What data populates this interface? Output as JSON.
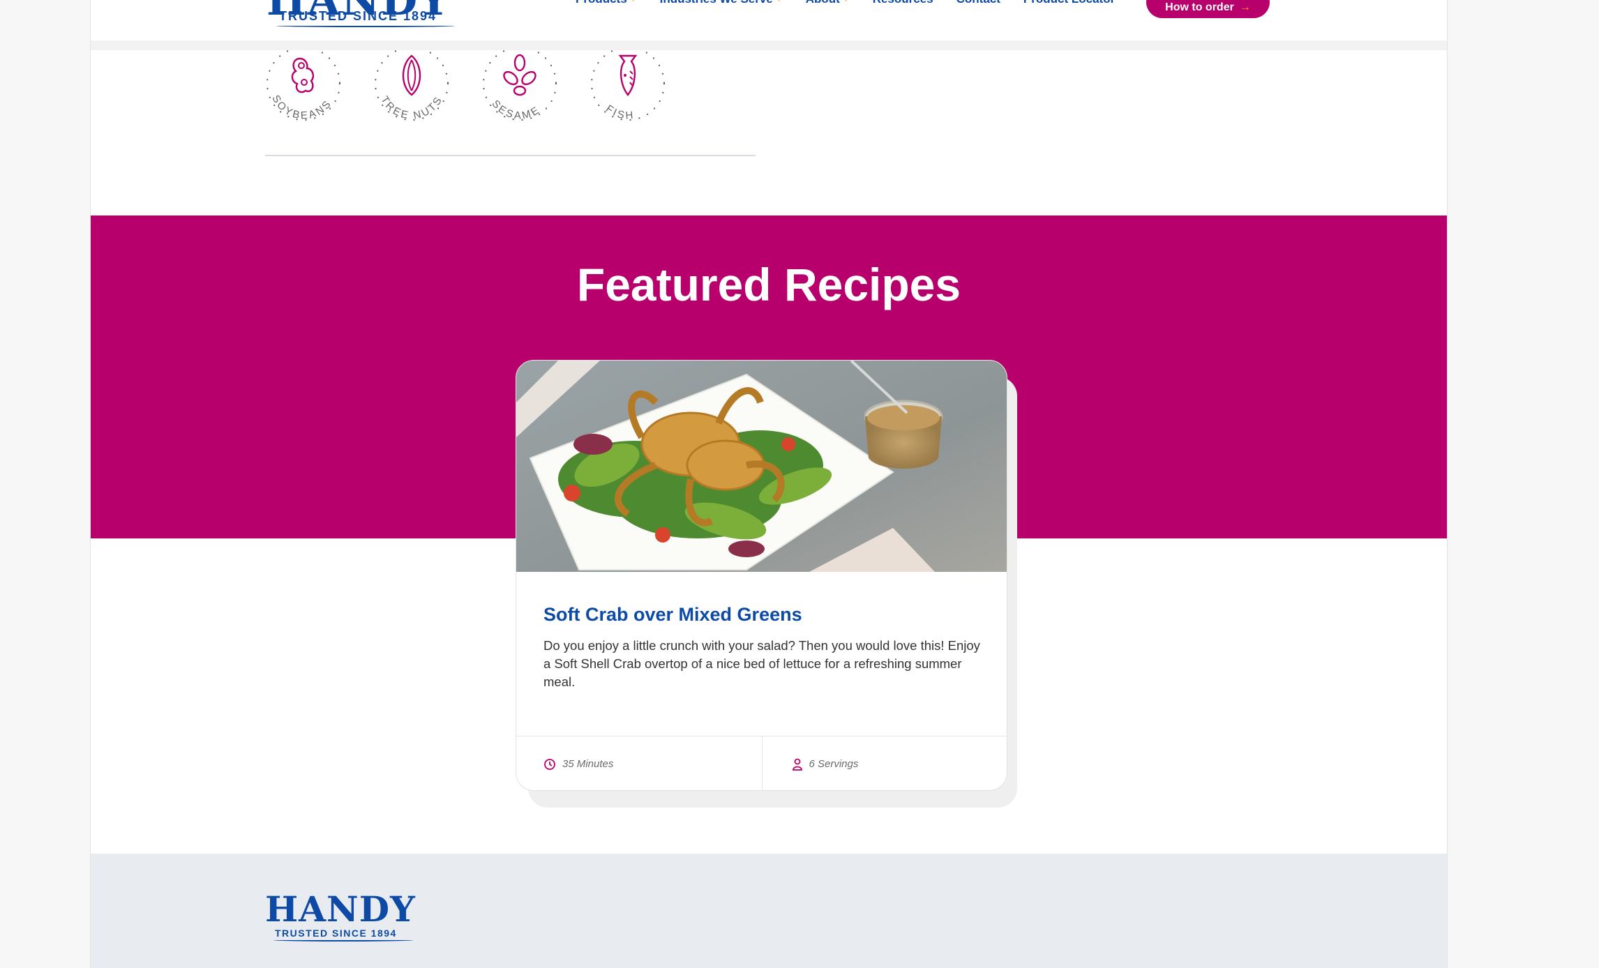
{
  "header": {
    "brand": "HANDY",
    "tagline": "TRUSTED SINCE 1894",
    "nav": [
      {
        "label": "Products",
        "has_dropdown": true
      },
      {
        "label": "Industries We Serve",
        "has_dropdown": true
      },
      {
        "label": "About",
        "has_dropdown": true
      },
      {
        "label": "Resources",
        "has_dropdown": false
      },
      {
        "label": "Contact",
        "has_dropdown": false
      },
      {
        "label": "Product Locator",
        "has_dropdown": false
      }
    ],
    "cta_label": "How to order"
  },
  "allergens": {
    "items": [
      {
        "label": "SOYBEANS",
        "icon": "soybean-icon"
      },
      {
        "label": "TREE NUTS",
        "icon": "tree-nut-icon"
      },
      {
        "label": "SESAME",
        "icon": "sesame-icon"
      },
      {
        "label": "FISH",
        "icon": "fish-icon"
      }
    ]
  },
  "featured": {
    "title": "Featured Recipes",
    "recipe": {
      "title": "Soft Crab over Mixed Greens",
      "description": "Do you enjoy a little crunch with your salad? Then you would love this! Enjoy a Soft Shell Crab overtop of a nice bed of lettuce for a refreshing summer meal.",
      "time": "35 Minutes",
      "servings": "6 Servings"
    }
  },
  "footer": {
    "brand": "HANDY",
    "tagline": "TRUSTED SINCE 1894"
  },
  "colors": {
    "brand_blue": "#0d4aa6",
    "brand_magenta": "#b8006d",
    "accent_orange": "#f6a21a",
    "footer_bg": "#e8ecf1"
  }
}
